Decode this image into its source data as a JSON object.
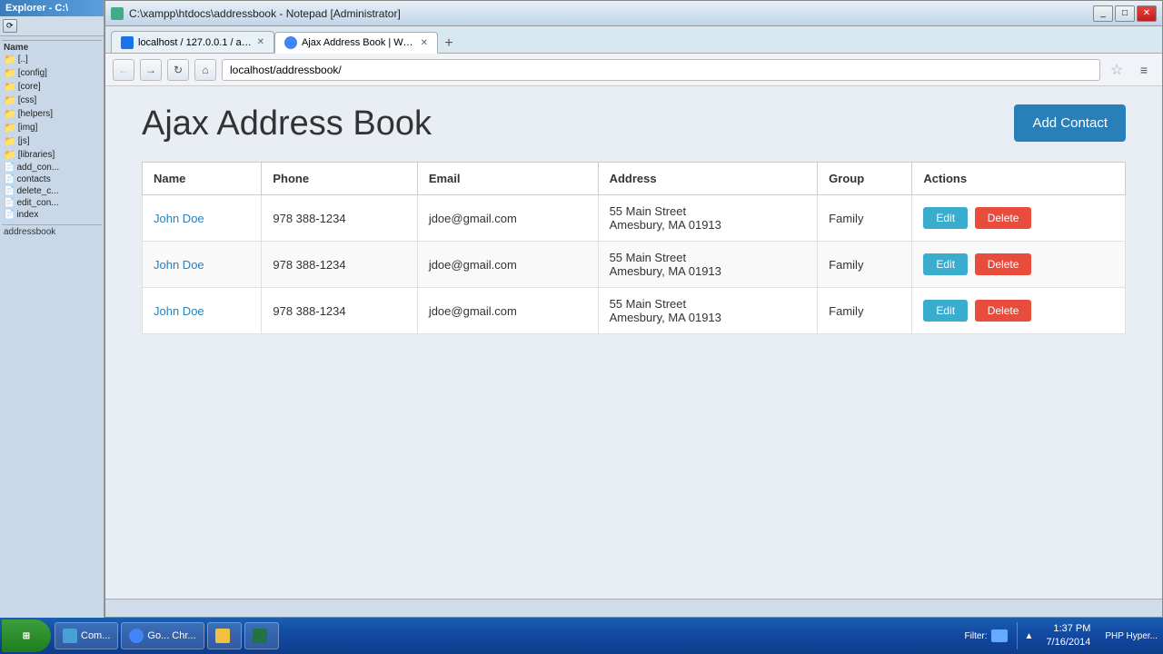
{
  "browser": {
    "title": "C:\\xampp\\htdocs\\addressbook - Notepad [Administrator]",
    "tabs": [
      {
        "label": "localhost / 127.0.0.1 / add...",
        "url": "localhost/127.0.0.1/add...",
        "active": false,
        "icon": "tab-icon"
      },
      {
        "label": "Ajax Address Book | Welco...",
        "url": "localhost/addressbook/",
        "active": true,
        "icon": "tab-icon"
      }
    ],
    "address": "localhost/addressbook/",
    "page": {
      "title": "Ajax Address Book",
      "add_button": "Add Contact",
      "table": {
        "headers": [
          "Name",
          "Phone",
          "Email",
          "Address",
          "Group",
          "Actions"
        ],
        "rows": [
          {
            "name": "John Doe",
            "phone": "978 388-1234",
            "email": "jdoe@gmail.com",
            "address_line1": "55 Main Street",
            "address_line2": "Amesbury, MA 01913",
            "group": "Family",
            "edit_label": "Edit",
            "delete_label": "Delete"
          },
          {
            "name": "John Doe",
            "phone": "978 388-1234",
            "email": "jdoe@gmail.com",
            "address_line1": "55 Main Street",
            "address_line2": "Amesbury, MA 01913",
            "group": "Family",
            "edit_label": "Edit",
            "delete_label": "Delete"
          },
          {
            "name": "John Doe",
            "phone": "978 388-1234",
            "email": "jdoe@gmail.com",
            "address_line1": "55 Main Street",
            "address_line2": "Amesbury, MA 01913",
            "group": "Family",
            "edit_label": "Edit",
            "delete_label": "Delete"
          }
        ]
      }
    }
  },
  "sidebar": {
    "header": "Explorer - C:\\",
    "name_label": "Name",
    "items": [
      {
        "label": "[..]",
        "type": "folder"
      },
      {
        "label": "[config]",
        "type": "folder"
      },
      {
        "label": "[core]",
        "type": "folder"
      },
      {
        "label": "[css]",
        "type": "folder"
      },
      {
        "label": "[helpers]",
        "type": "folder"
      },
      {
        "label": "[img]",
        "type": "folder"
      },
      {
        "label": "[js]",
        "type": "folder"
      },
      {
        "label": "[libraries]",
        "type": "folder"
      },
      {
        "label": "add_con...",
        "type": "file"
      },
      {
        "label": "contacts",
        "type": "file"
      },
      {
        "label": "delete_c...",
        "type": "file"
      },
      {
        "label": "edit_con...",
        "type": "file"
      },
      {
        "label": "index",
        "type": "file"
      }
    ],
    "bottom_label": "addressbook"
  },
  "taskbar": {
    "start_label": "Start",
    "items": [
      {
        "label": "Com...",
        "icon": "app"
      },
      {
        "label": "Go... Chr...",
        "icon": "chrome"
      }
    ],
    "time": "1:37 PM",
    "date": "7/16/2014",
    "filter_label": "Filter:",
    "bottom_label": "PHP Hyper..."
  },
  "status_bar": {
    "text": ""
  },
  "colors": {
    "accent_blue": "#2980b9",
    "edit_blue": "#3aaccd",
    "delete_red": "#e74c3c",
    "link_blue": "#2980b9"
  }
}
